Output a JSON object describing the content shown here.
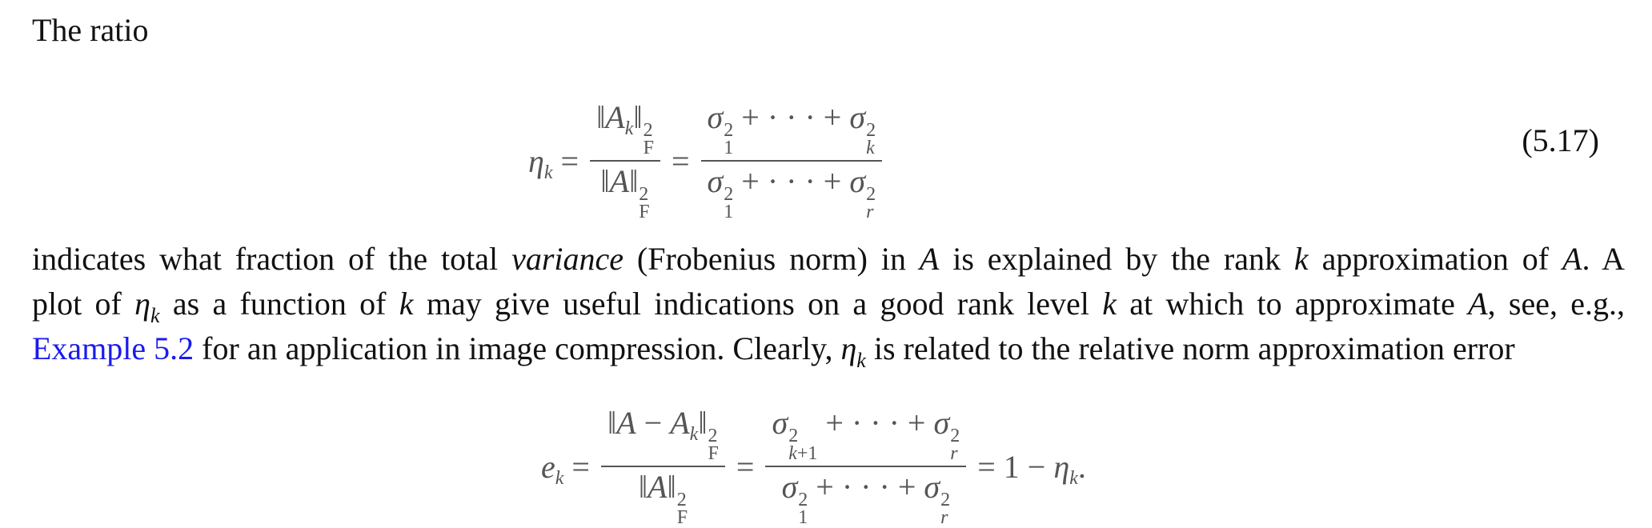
{
  "intro": "The ratio",
  "eq_5_17": {
    "lhs": "ηk",
    "num1": "‖Ak‖F2",
    "den1": "‖A‖F2",
    "num2": "σ12 + · · · + σk2",
    "den2": "σ12 + · · · + σr2",
    "number": "(5.17)"
  },
  "paragraph": {
    "line1_a": "indicates what fraction of the total ",
    "line1_b": "variance",
    "line1_c": " (Frobenius norm) in ",
    "line1_d": "A",
    "line1_e": " is explained by the rank ",
    "line1_f": "k",
    "line1_g": " approximation of ",
    "line1_h": "A",
    "line1_i": ". A",
    "line2_a": "plot of ",
    "line2_b": "η",
    "line2_c": "k",
    "line2_d": " as a function of ",
    "line2_e": "k",
    "line2_f": " may give useful indications on a good rank level ",
    "line2_g": "k",
    "line2_h": " at which to approximate ",
    "line2_i": "A",
    "line2_j": ", see, e.g.,",
    "link": "Example 5.2",
    "line3_a": " for an application in image compression. Clearly, ",
    "line3_b": "η",
    "line3_c": "k",
    "line3_d": " is related to the relative norm approximation error"
  },
  "eq_error": {
    "lhs": "ek",
    "num1": "‖A − Ak‖F2",
    "den1": "‖A‖F2",
    "num2": "σk+12 + · · · + σr2",
    "den2": "σ12 + · · · + σr2",
    "rhs": "= 1 − ηk."
  }
}
